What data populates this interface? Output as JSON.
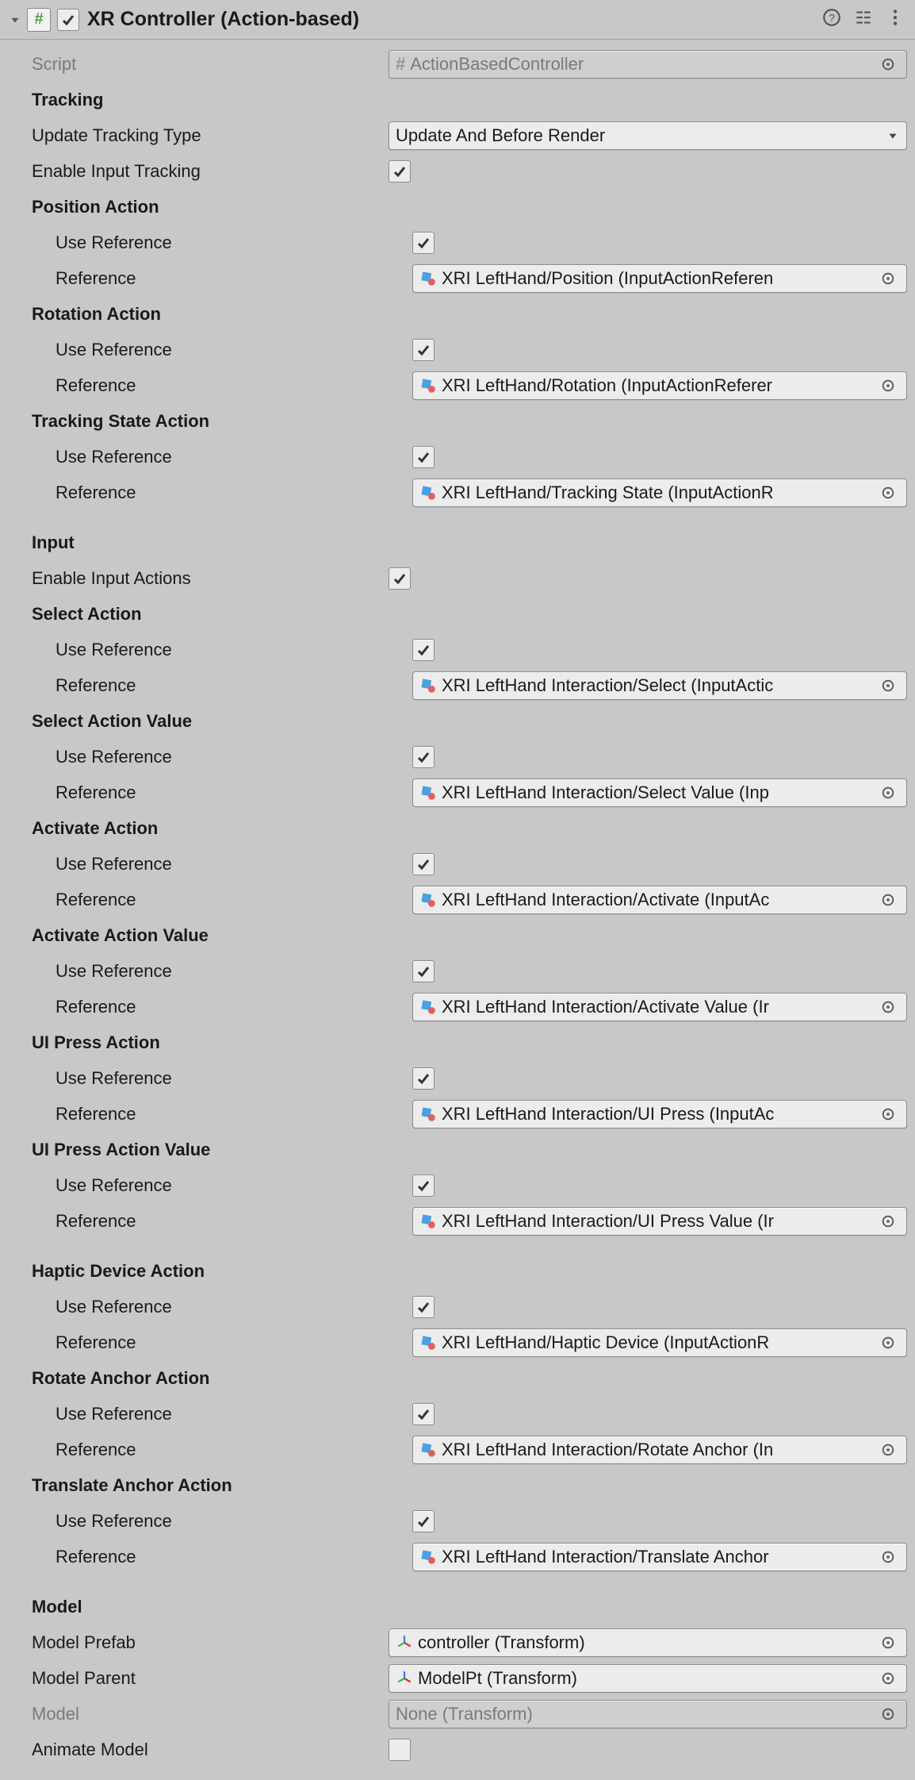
{
  "header": {
    "title": "XR Controller (Action-based)",
    "enabled": true
  },
  "script": {
    "label": "Script",
    "value": "ActionBasedController"
  },
  "sections": {
    "tracking": {
      "heading": "Tracking",
      "updateTrackingType": {
        "label": "Update Tracking Type",
        "value": "Update And Before Render"
      },
      "enableInputTracking": {
        "label": "Enable Input Tracking",
        "checked": true
      },
      "positionAction": {
        "heading": "Position Action",
        "useReference": {
          "label": "Use Reference",
          "checked": true
        },
        "reference": {
          "label": "Reference",
          "value": "XRI LeftHand/Position (InputActionReferen"
        }
      },
      "rotationAction": {
        "heading": "Rotation Action",
        "useReference": {
          "label": "Use Reference",
          "checked": true
        },
        "reference": {
          "label": "Reference",
          "value": "XRI LeftHand/Rotation (InputActionReferer"
        }
      },
      "trackingStateAction": {
        "heading": "Tracking State Action",
        "useReference": {
          "label": "Use Reference",
          "checked": true
        },
        "reference": {
          "label": "Reference",
          "value": "XRI LeftHand/Tracking State (InputActionR"
        }
      }
    },
    "input": {
      "heading": "Input",
      "enableInputActions": {
        "label": "Enable Input Actions",
        "checked": true
      },
      "selectAction": {
        "heading": "Select Action",
        "useReference": {
          "label": "Use Reference",
          "checked": true
        },
        "reference": {
          "label": "Reference",
          "value": "XRI LeftHand Interaction/Select (InputActic"
        }
      },
      "selectActionValue": {
        "heading": "Select Action Value",
        "useReference": {
          "label": "Use Reference",
          "checked": true
        },
        "reference": {
          "label": "Reference",
          "value": "XRI LeftHand Interaction/Select Value (Inp"
        }
      },
      "activateAction": {
        "heading": "Activate Action",
        "useReference": {
          "label": "Use Reference",
          "checked": true
        },
        "reference": {
          "label": "Reference",
          "value": "XRI LeftHand Interaction/Activate (InputAc"
        }
      },
      "activateActionValue": {
        "heading": "Activate Action Value",
        "useReference": {
          "label": "Use Reference",
          "checked": true
        },
        "reference": {
          "label": "Reference",
          "value": "XRI LeftHand Interaction/Activate Value (Ir"
        }
      },
      "uiPressAction": {
        "heading": "UI Press Action",
        "useReference": {
          "label": "Use Reference",
          "checked": true
        },
        "reference": {
          "label": "Reference",
          "value": "XRI LeftHand Interaction/UI Press (InputAc"
        }
      },
      "uiPressActionValue": {
        "heading": "UI Press Action Value",
        "useReference": {
          "label": "Use Reference",
          "checked": true
        },
        "reference": {
          "label": "Reference",
          "value": "XRI LeftHand Interaction/UI Press Value (Ir"
        }
      },
      "hapticDeviceAction": {
        "heading": "Haptic Device Action",
        "useReference": {
          "label": "Use Reference",
          "checked": true
        },
        "reference": {
          "label": "Reference",
          "value": "XRI LeftHand/Haptic Device (InputActionR"
        }
      },
      "rotateAnchorAction": {
        "heading": "Rotate Anchor Action",
        "useReference": {
          "label": "Use Reference",
          "checked": true
        },
        "reference": {
          "label": "Reference",
          "value": "XRI LeftHand Interaction/Rotate Anchor (In"
        }
      },
      "translateAnchorAction": {
        "heading": "Translate Anchor Action",
        "useReference": {
          "label": "Use Reference",
          "checked": true
        },
        "reference": {
          "label": "Reference",
          "value": "XRI LeftHand Interaction/Translate Anchor"
        }
      }
    },
    "model": {
      "heading": "Model",
      "modelPrefab": {
        "label": "Model Prefab",
        "value": "controller (Transform)"
      },
      "modelParent": {
        "label": "Model Parent",
        "value": "ModelPt (Transform)"
      },
      "model": {
        "label": "Model",
        "value": "None (Transform)"
      },
      "animateModel": {
        "label": "Animate Model",
        "checked": false
      }
    }
  }
}
